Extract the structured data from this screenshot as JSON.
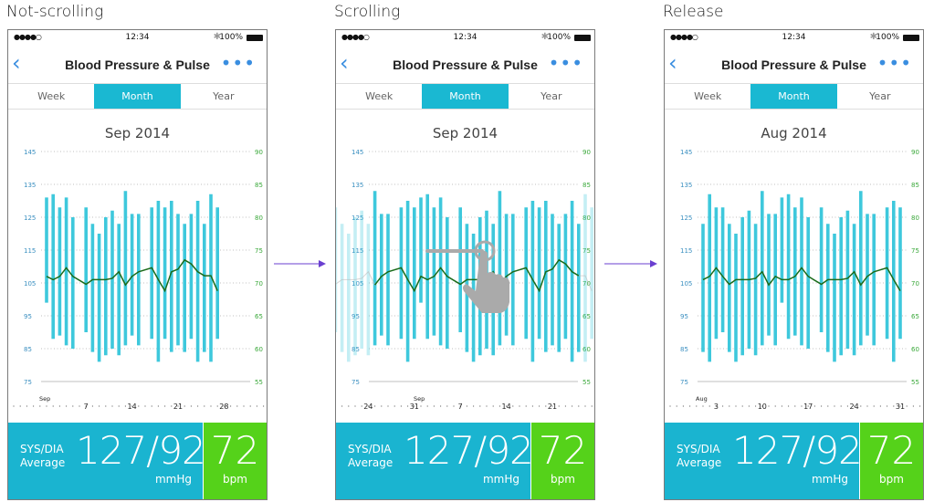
{
  "panels": [
    {
      "caption": "Not-scrolling",
      "status": {
        "signal": "●●●●○",
        "time": "12:34",
        "bluetooth": "✱",
        "battery": "100%"
      },
      "nav": {
        "back": "‹",
        "title": "Blood Pressure & Pulse",
        "more": "•••"
      },
      "tabs": [
        "Week",
        "Month",
        "Year"
      ],
      "active_tab": "Month",
      "month_label": "Sep 2014",
      "axis_month": "Sep",
      "xticks": [
        {
          "month": "Sep",
          "day": 7
        },
        {
          "month": "Sep",
          "day": 14
        },
        {
          "month": "Sep",
          "day": 21
        },
        {
          "month": "Sep",
          "day": 28
        }
      ],
      "footer": {
        "label1": "SYS/DIA",
        "label2": "Average",
        "bp": "127/92",
        "bp_unit": "mmHg",
        "pulse": "72",
        "pulse_unit": "bpm"
      }
    },
    {
      "caption": "Scrolling",
      "status": {
        "signal": "●●●●○",
        "time": "12:34",
        "bluetooth": "✱",
        "battery": "100%"
      },
      "nav": {
        "back": "‹",
        "title": "Blood Pressure & Pulse",
        "more": "•••"
      },
      "tabs": [
        "Week",
        "Month",
        "Year"
      ],
      "active_tab": "Month",
      "month_label": "Sep 2014",
      "axis_month": "Sep",
      "xticks": [
        {
          "month": "Aug",
          "day": 24
        },
        {
          "month": "Aug",
          "day": 31
        },
        {
          "month": "Sep",
          "day": 7
        },
        {
          "month": "Sep",
          "day": 14
        },
        {
          "month": "Sep",
          "day": 21
        }
      ],
      "gesture_icon": "swipe-hand-icon",
      "footer": {
        "label1": "SYS/DIA",
        "label2": "Average",
        "bp": "127/92",
        "bp_unit": "mmHg",
        "pulse": "72",
        "pulse_unit": "bpm"
      }
    },
    {
      "caption": "Release",
      "status": {
        "signal": "●●●●○",
        "time": "12:34",
        "bluetooth": "✱",
        "battery": "100%"
      },
      "nav": {
        "back": "‹",
        "title": "Blood Pressure & Pulse",
        "more": "•••"
      },
      "tabs": [
        "Week",
        "Month",
        "Year"
      ],
      "active_tab": "Month",
      "month_label": "Aug 2014",
      "axis_month": "Aug",
      "xticks": [
        {
          "month": "Aug",
          "day": 3
        },
        {
          "month": "Aug",
          "day": 10
        },
        {
          "month": "Aug",
          "day": 17
        },
        {
          "month": "Aug",
          "day": 24
        },
        {
          "month": "Aug",
          "day": 31
        }
      ],
      "footer": {
        "label1": "SYS/DIA",
        "label2": "Average",
        "bp": "127/92",
        "bp_unit": "mmHg",
        "pulse": "72",
        "pulse_unit": "bpm"
      }
    }
  ],
  "colors": {
    "bar": "#3ec8dc",
    "pulse_line": "#1a6b1a",
    "left_axis": "#3a8fc0",
    "right_axis": "#3aa83a",
    "tab_active": "#1ab8d2",
    "footer_bp": "#1ab4d0",
    "footer_pulse": "#55d21a",
    "arrow": "#6a3fd0",
    "accent": "#3a8ee0"
  },
  "chart_data": {
    "type": "bar",
    "left_axis": {
      "ticks": [
        145,
        135,
        125,
        115,
        105,
        95,
        85,
        75
      ],
      "range": [
        75,
        145
      ]
    },
    "right_axis": {
      "ticks": [
        90,
        85,
        80,
        75,
        70,
        65,
        60,
        55
      ],
      "range": [
        55,
        90
      ]
    },
    "grid": true,
    "Aug": {
      "days": [
        1,
        2,
        3,
        4,
        5,
        6,
        7,
        8,
        9,
        10,
        11,
        12,
        13,
        14,
        15,
        16,
        17,
        19,
        20,
        21,
        22,
        23,
        24,
        25,
        26,
        27,
        29,
        30,
        31
      ],
      "sys": [
        123,
        132,
        128,
        128,
        123,
        120,
        125,
        127,
        123,
        133,
        126,
        126,
        131,
        132,
        128,
        131,
        125,
        128,
        123,
        120,
        125,
        127,
        123,
        133,
        126,
        126,
        128,
        130,
        128
      ],
      "dia": [
        84,
        81,
        88,
        90,
        84,
        81,
        83,
        85,
        83,
        86,
        89,
        86,
        99,
        88,
        89,
        86,
        85,
        90,
        84,
        81,
        83,
        85,
        83,
        86,
        89,
        86,
        88,
        81,
        88
      ],
      "pulse": [
        70.5,
        71,
        72.3,
        71,
        69.8,
        70.5,
        70.5,
        70.5,
        70.7,
        71.7,
        69.7,
        71,
        70.5,
        70.5,
        71,
        72.3,
        71,
        69.8,
        70.5,
        70.5,
        70.5,
        70.7,
        71.7,
        69.7,
        71,
        71.7,
        72.3,
        70.5,
        68.8
      ]
    },
    "Sep": {
      "days": [
        1,
        2,
        3,
        4,
        5,
        7,
        8,
        9,
        10,
        11,
        12,
        13,
        14,
        15,
        17,
        18,
        19,
        20,
        21,
        22,
        23,
        24,
        25,
        26,
        27
      ],
      "sys": [
        131,
        132,
        128,
        131,
        125,
        128,
        123,
        120,
        125,
        127,
        123,
        133,
        126,
        126,
        128,
        130,
        128,
        130,
        126,
        123,
        126,
        130,
        123,
        132,
        128
      ],
      "dia": [
        99,
        88,
        89,
        86,
        85,
        90,
        84,
        81,
        83,
        85,
        83,
        86,
        89,
        86,
        88,
        81,
        88,
        84,
        86,
        84,
        88,
        81,
        84,
        81,
        88
      ],
      "pulse": [
        71,
        70.5,
        71,
        72.3,
        71,
        69.8,
        70.5,
        70.5,
        70.5,
        70.7,
        71.7,
        69.7,
        71,
        71.7,
        72.3,
        70.5,
        68.8,
        71.7,
        72.1,
        73.5,
        72.9,
        71.7,
        71.1,
        71.1,
        68.8
      ]
    }
  }
}
